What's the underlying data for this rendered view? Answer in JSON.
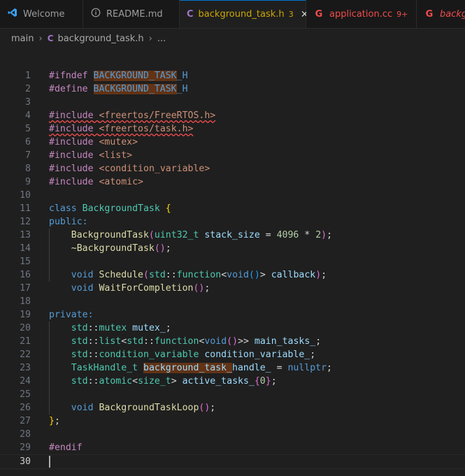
{
  "tabs": [
    {
      "label": "Welcome",
      "icon": "vscode-logo-icon"
    },
    {
      "label": "README.md",
      "icon": "info-icon"
    },
    {
      "label": "background_task.h",
      "icon": "c-file-icon",
      "badge": "3",
      "active": true
    },
    {
      "label": "application.cc",
      "icon": "cpp-file-icon",
      "badge": "9+"
    },
    {
      "label": "backgr",
      "icon": "cpp-file-icon"
    }
  ],
  "breadcrumb": {
    "folder": "main",
    "file": "background_task.h",
    "tail": "..."
  },
  "line_numbers": [
    "1",
    "2",
    "3",
    "4",
    "5",
    "6",
    "7",
    "8",
    "9",
    "10",
    "11",
    "12",
    "13",
    "14",
    "15",
    "16",
    "17",
    "18",
    "19",
    "20",
    "21",
    "22",
    "23",
    "24",
    "25",
    "26",
    "27",
    "28",
    "29",
    "30"
  ],
  "code": {
    "ifndef": "#ifndef",
    "define": "#define",
    "include": "#include",
    "endif": "#endif",
    "guard_a": "BACKGROUND_TASK",
    "guard_b": "_H",
    "h_freertos": "<freertos/FreeRTOS.h>",
    "h_task": "<freertos/task.h>",
    "h_mutex": "<mutex>",
    "h_list": "<list>",
    "h_cv": "<condition_variable>",
    "h_atomic": "<atomic>",
    "kw_class": "class",
    "class_name": "BackgroundTask",
    "public": "public:",
    "private": "private:",
    "ctor": "BackgroundTask",
    "dtor": "~BackgroundTask",
    "uint32": "uint32_t",
    "stack_size": "stack_size",
    "num_4096": "4096",
    "num_2": "2",
    "kw_void": "void",
    "schedule": "Schedule",
    "std": "std",
    "function": "function",
    "callback": "callback",
    "wait": "WaitForCompletion",
    "mutex_t": "mutex",
    "mutex_v": "mutex_",
    "list_t": "list",
    "main_tasks": "main_tasks_",
    "cv_t": "condition_variable",
    "cv_v": "condition_variable_",
    "taskhandle": "TaskHandle_t",
    "bgt_hl": "background_task",
    "bgt_tail": "handle_",
    "nullptr": "nullptr",
    "atomic_t": "atomic",
    "size_t": "size_t",
    "active_tasks": "active_tasks_",
    "num_0": "0",
    "loop": "BackgroundTaskLoop"
  }
}
